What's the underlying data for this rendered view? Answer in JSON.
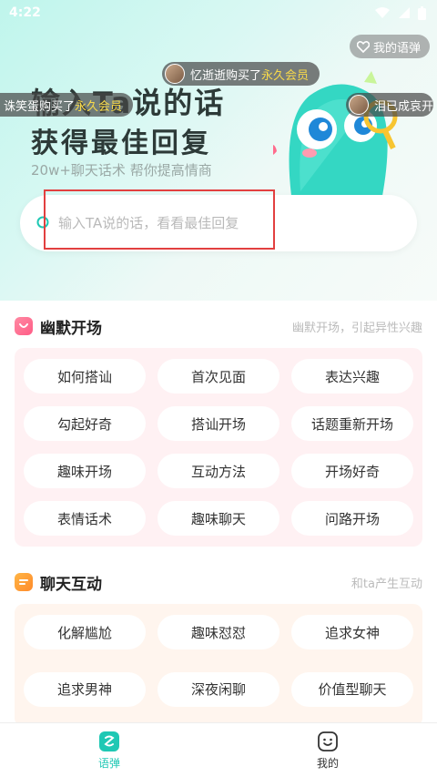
{
  "status_bar": {
    "time": "4:22"
  },
  "hero": {
    "my_danmu_label": "我的语弹",
    "title_line1": "输入Ta说的话",
    "title_line2": "获得最佳回复",
    "subtitle": "20w+聊天话术 帮你提高情商"
  },
  "tickers": [
    {
      "name": "忆逝逝购买了",
      "item": "永久会员"
    },
    {
      "name": "诛笑蛋购买了",
      "item": "永久会员"
    },
    {
      "name": "泪已成哀开",
      "item": ""
    }
  ],
  "search": {
    "placeholder": "输入TA说的话，看看最佳回复"
  },
  "sections": [
    {
      "title": "幽默开场",
      "hint": "幽默开场，引起异性兴趣",
      "chips": [
        "如何搭讪",
        "首次见面",
        "表达兴趣",
        "勾起好奇",
        "搭讪开场",
        "话题重新开场",
        "趣味开场",
        "互动方法",
        "开场好奇",
        "表情话术",
        "趣味聊天",
        "问路开场"
      ]
    },
    {
      "title": "聊天互动",
      "hint": "和ta产生互动",
      "chips": [
        "化解尴尬",
        "趣味怼怼",
        "追求女神",
        "追求男神",
        "深夜闲聊",
        "价值型聊天"
      ]
    }
  ],
  "nav": {
    "tab1": "语弹",
    "tab2": "我的"
  },
  "colors": {
    "accent": "#1fc8b4",
    "section1_bg": "#fff1f3",
    "section2_bg": "#fff5ee",
    "highlight": "#f7d94a"
  }
}
